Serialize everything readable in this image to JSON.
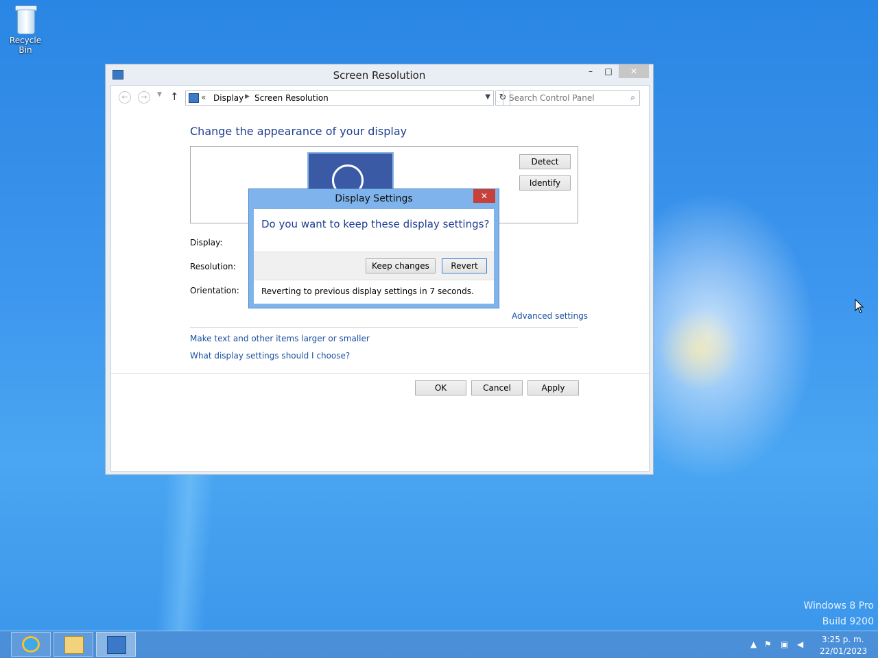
{
  "desktop": {
    "recycle_bin_label": "Recycle Bin",
    "watermark_line1": "Windows 8 Pro",
    "watermark_line2": "Build 9200"
  },
  "window": {
    "title": "Screen Resolution",
    "controls": {
      "minimize": "–",
      "maximize": "□",
      "close": "✕"
    },
    "breadcrumb_chevron": "«",
    "breadcrumb": [
      "Display",
      "Screen Resolution"
    ],
    "search_placeholder": "Search Control Panel",
    "heading": "Change the appearance of your display",
    "detect_label": "Detect",
    "identify_label": "Identify",
    "display_label": "Display:",
    "resolution_label": "Resolution:",
    "orientation_label": "Orientation:",
    "advanced_link": "Advanced settings",
    "link_text_size": "Make text and other items larger or smaller",
    "link_which_settings": "What display settings should I choose?",
    "ok_label": "OK",
    "cancel_label": "Cancel",
    "apply_label": "Apply"
  },
  "dialog": {
    "title": "Display Settings",
    "question": "Do you want to keep these display settings?",
    "keep_label": "Keep changes",
    "revert_label": "Revert",
    "status": "Reverting to previous display settings in 7 seconds.",
    "close": "✕"
  },
  "taskbar": {
    "apps": [
      "internet-explorer",
      "file-explorer",
      "control-panel"
    ],
    "time": "3:25 p. m.",
    "date": "22/01/2023"
  },
  "colors": {
    "accent_link": "#1a4fa0",
    "heading": "#1e3d8f",
    "dialog_frame": "#7fb3ec",
    "close_red": "#c7403a"
  }
}
